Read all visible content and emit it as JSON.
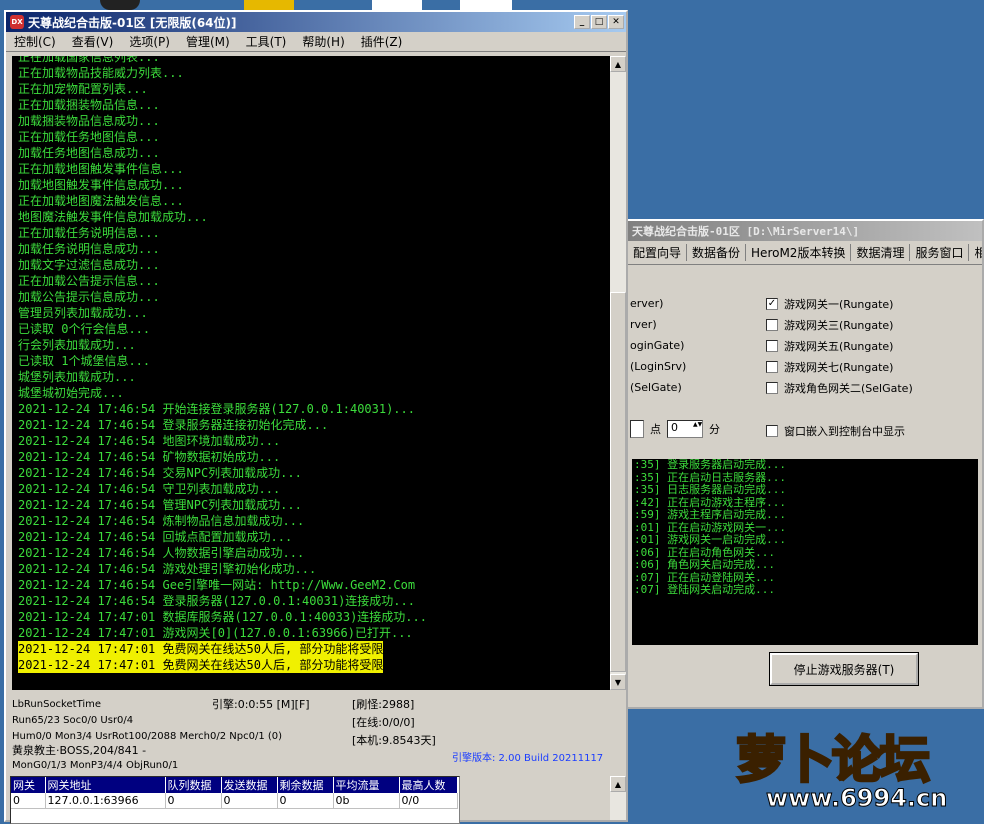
{
  "main_window": {
    "title": "天尊战纪合击版-01区 [无限版(64位)]",
    "icon_text": "DX",
    "menu": [
      "控制(C)",
      "查看(V)",
      "选项(P)",
      "管理(M)",
      "工具(T)",
      "帮助(H)",
      "插件(Z)"
    ]
  },
  "log_lines": [
    "正在加载国家信息列表...",
    "正在加载物品技能威力列表...",
    "正在加宠物配置列表...",
    "正在加载捆装物品信息...",
    "加载捆装物品信息成功...",
    "正在加载任务地图信息...",
    "加载任务地图信息成功...",
    "正在加载地图触发事件信息...",
    "加载地图触发事件信息成功...",
    "正在加载地图魔法触发信息...",
    "地图魔法触发事件信息加载成功...",
    "正在加载任务说明信息...",
    "加载任务说明信息成功...",
    "加载文字过滤信息成功...",
    "正在加载公告提示信息...",
    "加载公告提示信息成功...",
    "管理员列表加载成功...",
    "已读取 0个行会信息...",
    "行会列表加载成功...",
    "已读取 1个城堡信息...",
    "城堡列表加载成功...",
    "城堡城初始完成...",
    "2021-12-24 17:46:54 开始连接登录服务器(127.0.0.1:40031)...",
    "2021-12-24 17:46:54 登录服务器连接初始化完成...",
    "2021-12-24 17:46:54 地图环境加载成功...",
    "2021-12-24 17:46:54 矿物数据初始成功...",
    "2021-12-24 17:46:54 交易NPC列表加载成功...",
    "2021-12-24 17:46:54 守卫列表加载成功...",
    "2021-12-24 17:46:54 管理NPC列表加载成功...",
    "2021-12-24 17:46:54 炼制物品信息加载成功...",
    "2021-12-24 17:46:54 回城点配置加载成功...",
    "2021-12-24 17:46:54 人物数据引擎启动成功...",
    "2021-12-24 17:46:54 游戏处理引擎初始化成功...",
    "2021-12-24 17:46:54 Gee引擎唯一网站: http://Www.GeeM2.Com",
    "2021-12-24 17:46:54 登录服务器(127.0.0.1:40031)连接成功...",
    "2021-12-24 17:47:01 数据库服务器(127.0.0.1:40033)连接成功...",
    "2021-12-24 17:47:01 游戏网关[0](127.0.0.1:63966)已打开..."
  ],
  "log_highlight": [
    "2021-12-24 17:47:01 免费网关在线达50人后, 部分功能将受限",
    "2021-12-24 17:47:01 免费网关在线达50人后, 部分功能将受限"
  ],
  "status": {
    "line1": "LbRunSocketTime",
    "line2": "Run65/23 Soc0/0 Usr0/4",
    "line3": "Hum0/0 Mon3/4 UsrRot100/2088 Merch0/2 Npc0/1 (0)",
    "line4": "黄泉教主·BOSS,204/841 -",
    "line5": "MonG0/1/3 MonP3/4/4 ObjRun0/1",
    "timer": "引擎:0:0:55 [M][F]",
    "refresh": "[刷怪:2988]",
    "online": "[在线:0/0/0]",
    "local": "[本机:9.8543天]",
    "version": "引擎版本: 2.00 Build 20211117"
  },
  "gate_table": {
    "headers": [
      "网关",
      "网关地址",
      "队列数据",
      "发送数据",
      "剩余数据",
      "平均流量",
      "最高人数"
    ],
    "rows": [
      [
        "0",
        "127.0.0.1:63966",
        "0",
        "0",
        "0",
        "0b",
        "0/0"
      ]
    ]
  },
  "control_window": {
    "title": "天尊战纪合击版-01区 [D:\\MirServer14\\]",
    "tabs": [
      "配置向导",
      "数据备份",
      "HeroM2版本转换",
      "数据清理",
      "服务窗口",
      "相关"
    ],
    "left_opts": [
      "erver)",
      "rver)",
      "oginGate)",
      "(LoginSrv)",
      "(SelGate)"
    ],
    "right_opts": [
      {
        "label": "游戏网关一(Rungate)",
        "checked": true
      },
      {
        "label": "游戏网关三(Rungate)",
        "checked": false
      },
      {
        "label": "游戏网关五(Rungate)",
        "checked": false
      },
      {
        "label": "游戏网关七(Rungate)",
        "checked": false
      },
      {
        "label": "游戏角色网关二(SelGate)",
        "checked": false
      }
    ],
    "point_label": "点",
    "minute_value": "0",
    "minute_label": "分",
    "embed_label": "窗口嵌入到控制台中显示",
    "log": [
      ":35] 登录服务器启动完成...",
      ":35] 正在启动日志服务器...",
      ":35] 日志服务器启动完成...",
      ":42] 正在启动游戏主程序...",
      ":59] 游戏主程序启动完成...",
      ":01] 正在启动游戏网关一...",
      ":01] 游戏网关一启动完成...",
      ":06] 正在启动角色网关...",
      ":06] 角色网关启动完成...",
      ":07] 正在启动登陆网关...",
      ":07] 登陆网关启动完成..."
    ],
    "stop_button": "停止游戏服务器(T)"
  },
  "watermark": {
    "title": "萝卜论坛",
    "url": "www.6994.cn"
  }
}
